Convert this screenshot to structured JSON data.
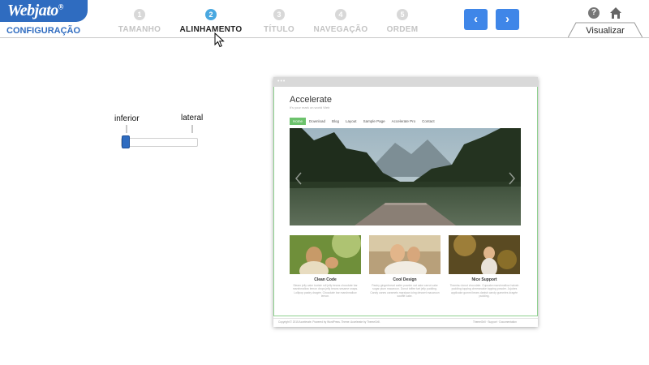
{
  "header": {
    "logo_text": "Webjato",
    "logo_mark": "®",
    "section_label": "CONFIGURAÇÃO",
    "steps": [
      {
        "num": "1",
        "label": "TAMANHO",
        "active": false
      },
      {
        "num": "2",
        "label": "ALINHAMENTO",
        "active": true
      },
      {
        "num": "3",
        "label": "TÍTULO",
        "active": false
      },
      {
        "num": "4",
        "label": "NAVEGAÇÃO",
        "active": false
      },
      {
        "num": "5",
        "label": "ORDEM",
        "active": false
      }
    ],
    "prev_icon": "chevron-left-icon",
    "prev_glyph": "‹",
    "next_icon": "chevron-right-icon",
    "next_glyph": "›",
    "help_glyph": "?",
    "home_icon": "home-icon",
    "visualizar_label": "Visualizar",
    "accent_color": "#3f86e8",
    "active_step_color": "#4aa8e0"
  },
  "slider": {
    "label_left": "inferior",
    "label_right": "lateral",
    "value": 0
  },
  "preview": {
    "dots": "•••",
    "site_title": "Accelerate",
    "site_tagline": "It's your mark on world Web",
    "menu": [
      "Home",
      "Download",
      "Blog",
      "Layout",
      "Sample Page",
      "Accelerate Pro",
      "Contact"
    ],
    "cards": [
      {
        "title": "Clean Code",
        "text": "Steam jelly cake tootsie roll jelly beans chocolate bar marshmallow lemon drops jelly beans sesame snaps. Lollipop pastry dragée. Chocolate bar marshmallow lemon."
      },
      {
        "title": "Cool Design",
        "text": "Pastry gingerbread wafer powder oat cake carrot cake sugar plum macaroon. Donut toffee tart jelly pudding. Candy canes caramels marzipan icing dessert macaroon soufflé cake."
      },
      {
        "title": "Nice Support",
        "text": "Tiramisu donut chocolate. Cupcake marshmallow halvah pudding topping cheesecake topping powder. Jujubes applicake gummi bears danish candy gummies dragée pudding."
      }
    ],
    "footer_left": "Copyright © 2015 Accelerate. Powered by WordPress. Theme: Accelerate by ThemeGrill.",
    "footer_right": "ThemeGrill   ·   Support   ·   Documentation"
  }
}
